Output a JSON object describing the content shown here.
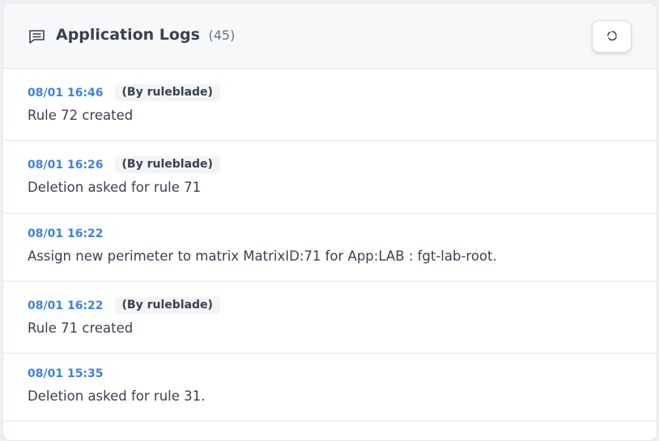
{
  "header": {
    "title": "Application Logs",
    "count": "(45)",
    "icon": "message-square-icon",
    "refresh_icon": "refresh-icon"
  },
  "colors": {
    "timestamp": "#3f84d8",
    "text": "#3a4150",
    "header_bg": "#f6f8fa",
    "border": "#e3e6ea"
  },
  "logs": [
    {
      "time": "08/01 16:46",
      "user": "(By ruleblade)",
      "message": "Rule 72 created"
    },
    {
      "time": "08/01 16:26",
      "user": "(By ruleblade)",
      "message": "Deletion asked for rule 71"
    },
    {
      "time": "08/01 16:22",
      "user": "",
      "message": "Assign new perimeter to matrix MatrixID:71 for App:LAB : fgt-lab-root."
    },
    {
      "time": "08/01 16:22",
      "user": "(By ruleblade)",
      "message": "Rule 71 created"
    },
    {
      "time": "08/01 15:35",
      "user": "",
      "message": "Deletion asked for rule 31."
    }
  ]
}
